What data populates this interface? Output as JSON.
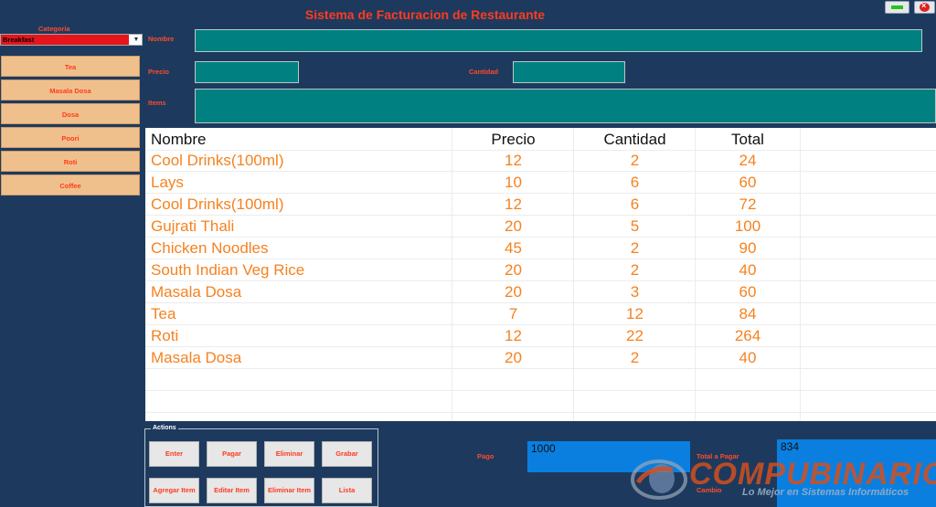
{
  "app": {
    "title": "Sistema de Facturacion de Restaurante"
  },
  "window": {
    "close_glyph": "×"
  },
  "sidebar": {
    "categoria_label": "Categoria",
    "selected_category": "Breakfast",
    "items": [
      {
        "label": "Tea"
      },
      {
        "label": "Masala Dosa"
      },
      {
        "label": "Dosa"
      },
      {
        "label": "Poori"
      },
      {
        "label": "Roti"
      },
      {
        "label": "Coffee"
      }
    ]
  },
  "form": {
    "nombre_label": "Nombre",
    "precio_label": "Precio",
    "cantidad_label": "Cantidad",
    "items_label": "Items",
    "nombre_value": "",
    "precio_value": "",
    "cantidad_value": "",
    "items_value": ""
  },
  "table": {
    "headers": {
      "nombre": "Nombre",
      "precio": "Precio",
      "cantidad": "Cantidad",
      "total": "Total"
    },
    "rows": [
      {
        "nombre": "Cool Drinks(100ml)",
        "precio": "12",
        "cantidad": "2",
        "total": "24"
      },
      {
        "nombre": "Lays",
        "precio": "10",
        "cantidad": "6",
        "total": "60"
      },
      {
        "nombre": "Cool Drinks(100ml)",
        "precio": "12",
        "cantidad": "6",
        "total": "72"
      },
      {
        "nombre": "Gujrati Thali",
        "precio": "20",
        "cantidad": "5",
        "total": "100"
      },
      {
        "nombre": "Chicken Noodles",
        "precio": "45",
        "cantidad": "2",
        "total": "90"
      },
      {
        "nombre": "South Indian Veg Rice",
        "precio": "20",
        "cantidad": "2",
        "total": "40"
      },
      {
        "nombre": "Masala Dosa",
        "precio": "20",
        "cantidad": "3",
        "total": "60"
      },
      {
        "nombre": "Tea",
        "precio": "7",
        "cantidad": "12",
        "total": "84"
      },
      {
        "nombre": "Roti",
        "precio": "12",
        "cantidad": "22",
        "total": "264"
      },
      {
        "nombre": "Masala Dosa",
        "precio": "20",
        "cantidad": "2",
        "total": "40"
      }
    ]
  },
  "actions": {
    "legend": "Actions",
    "enter": "Enter",
    "pagar": "Pagar",
    "eliminar": "Eliminar",
    "grabar": "Grabar",
    "agregar_item": "Agregar Item",
    "editar_item": "Editar Item",
    "eliminar_item": "Eliminar Item",
    "lista": "Lista"
  },
  "payment": {
    "pago_label": "Pago",
    "pago_value": "1000",
    "total_label": "Total a Pagar",
    "total_value": "834",
    "cambio_label": "Cambio"
  },
  "watermark": {
    "brand": "COMPUBINARIO",
    "tagline": "Lo Mejor en Sistemas Informáticos"
  },
  "colors": {
    "background": "#1d3a5e",
    "accent_red": "#ff3b1f",
    "menu_button": "#f0c08c",
    "input_teal": "#008080",
    "payment_blue": "#0a7fe0",
    "row_text_orange": "#f58220"
  }
}
